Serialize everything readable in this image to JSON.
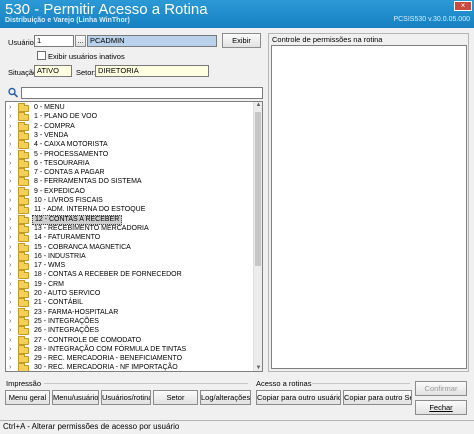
{
  "window": {
    "title": "530 - Permitir Acesso a Rotina",
    "subtitle": "Distribuição e Varejo (Linha WinThor)",
    "code": "PCSIS530 v.30.0.05.000"
  },
  "form": {
    "usuario_label": "Usuário:",
    "usuario_code": "1",
    "ellipsis": "...",
    "usuario_name": "PCADMIN",
    "exibir_button": "Exibir",
    "exibir_inativos_label": "Exibir usuários inativos",
    "situacao_label": "Situação:",
    "situacao_value": "ATIVO",
    "setor_label": "Setor:",
    "setor_value": "DIRETORIA"
  },
  "search": {
    "icon": "search-icon",
    "value": ""
  },
  "tree": {
    "items": [
      "0 - MENU",
      "1 - PLANO DE VOO",
      "2 - COMPRA",
      "3 - VENDA",
      "4 - CAIXA MOTORISTA",
      "5 - PROCESSAMENTO",
      "6 - TESOURARIA",
      "7 - CONTAS A PAGAR",
      "8 - FERRAMENTAS DO SISTEMA",
      "9 - EXPEDICAO",
      "10 - LIVROS FISCAIS",
      "11 - ADM. INTERNA DO ESTOQUE",
      "12 - CONTAS A RECEBER",
      "13 - RECEBIMENTO MERCADORIA",
      "14 - FATURAMENTO",
      "15 - COBRANCA MAGNETICA",
      "16 - INDUSTRIA",
      "17 - WMS",
      "18 - CONTAS A RECEBER DE FORNECEDOR",
      "19 - CRM",
      "20 - AUTO SERVICO",
      "21 - CONTÁBIL",
      "23 - FARMA-HOSPITALAR",
      "25 - INTEGRAÇÕES",
      "26 - INTEGRAÇÕES",
      "27 - CONTROLE DE COMODATO",
      "28 - INTEGRAÇÃO COM FÓRMULA DE TINTAS",
      "29 - REC. MERCADORIA - BENEFICIAMENTO",
      "30 - REC. MERCADORIA - NF IMPORTAÇÃO"
    ],
    "selected_index": 12
  },
  "permissions": {
    "label": "Controle de permissões na rotina"
  },
  "impressao": {
    "label": "Impressão",
    "buttons": [
      "Menu geral",
      "Menu/usuário",
      "Usuários/rotina",
      "Setor",
      "Log/alterações"
    ]
  },
  "acesso": {
    "label": "Acesso a rotinas",
    "buttons": [
      "Copiar para outro usuário",
      "Copiar para outro Setor"
    ]
  },
  "actions": {
    "confirmar": "Confirmar",
    "fechar": "Fechar"
  },
  "status": {
    "text": "Ctrl+A - Alterar permissões de acesso por usuário"
  }
}
